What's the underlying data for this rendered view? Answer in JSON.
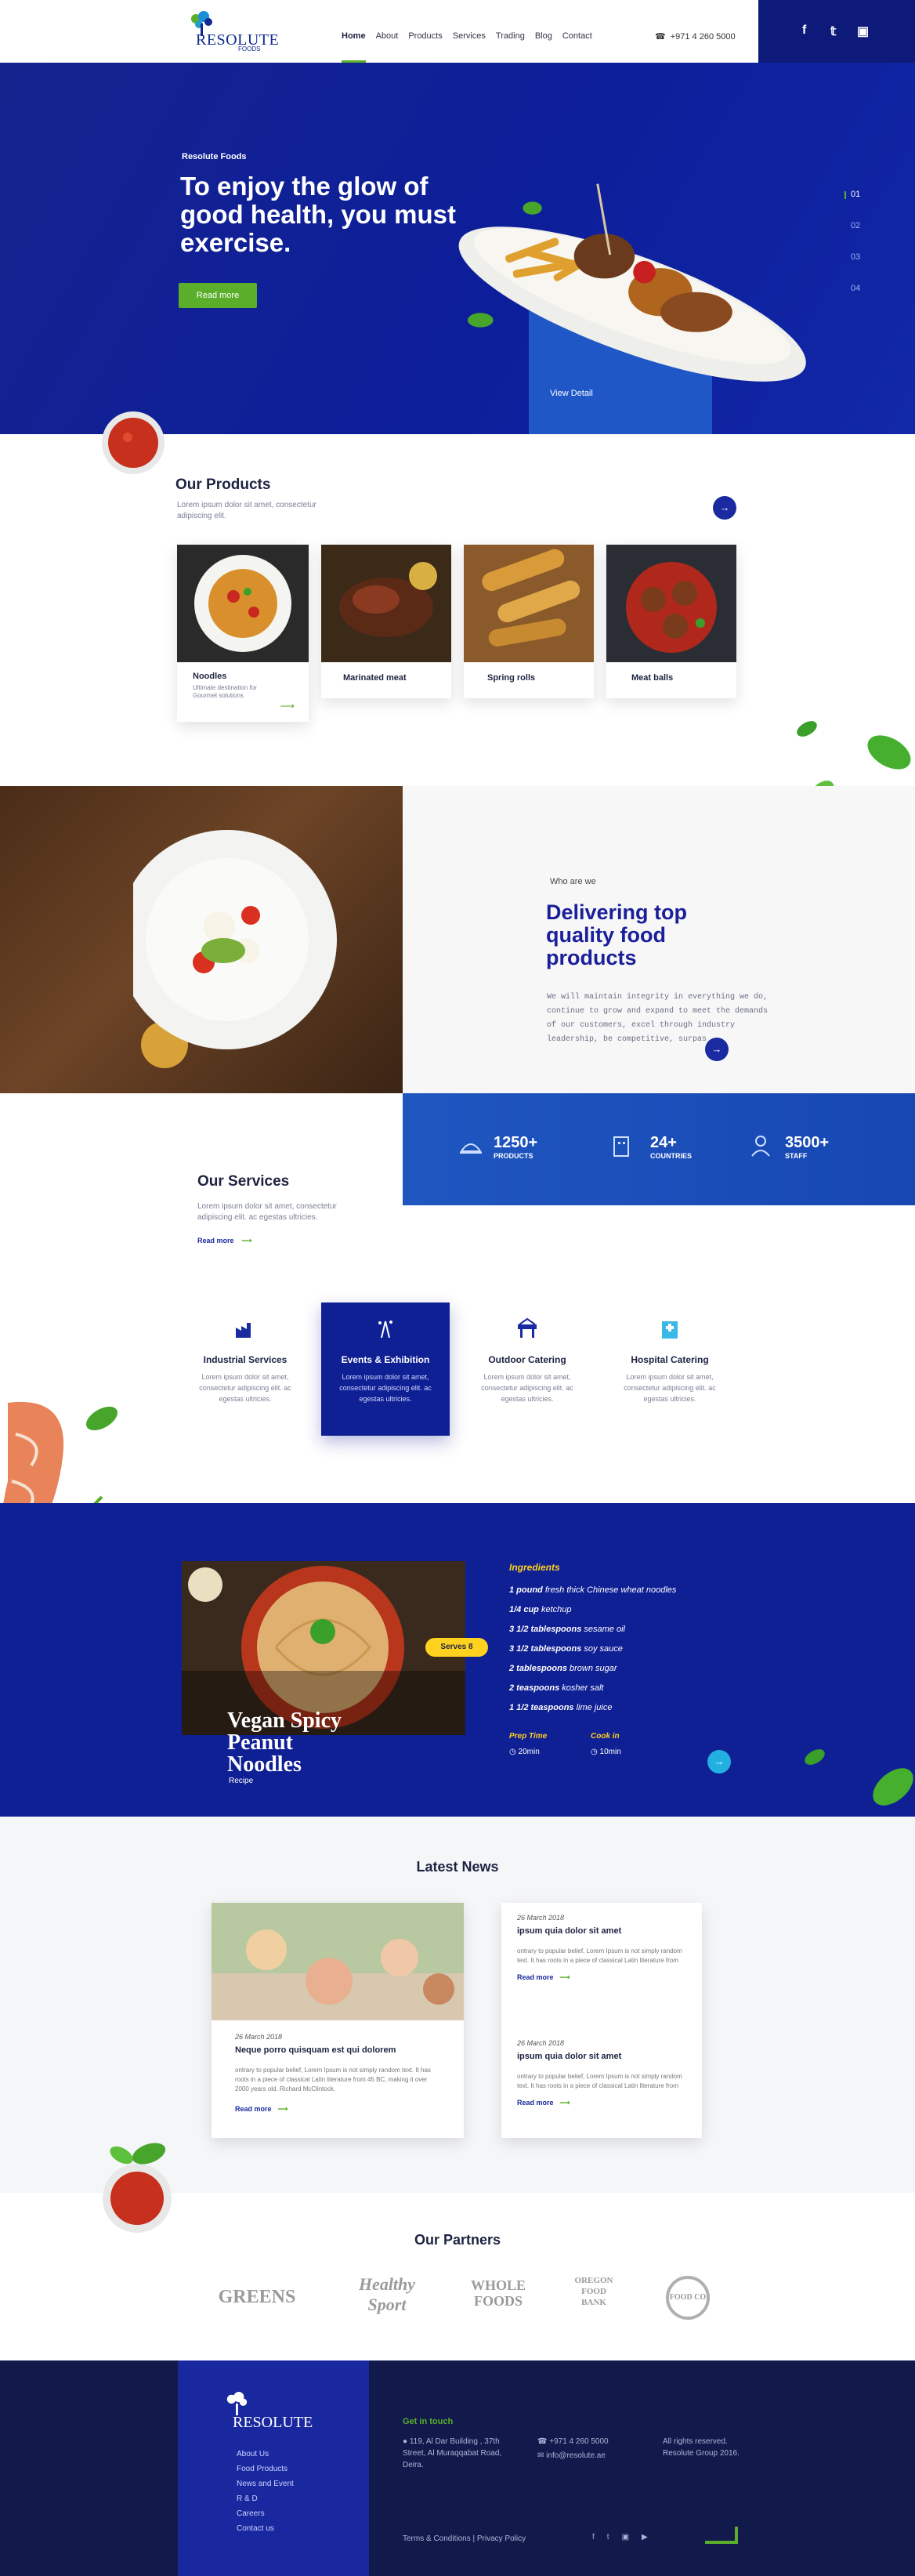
{
  "header": {
    "logo_text": "RESOLUTE",
    "logo_sub": "FOODS",
    "nav": [
      "Home",
      "About",
      "Products",
      "Services",
      "Trading",
      "Blog",
      "Contact"
    ],
    "phone": "+971 4 260 5000",
    "social": [
      "f",
      "t",
      "ig"
    ]
  },
  "hero": {
    "kicker": "Resolute Foods",
    "title": "To enjoy the glow of good health, you must exercise.",
    "cta": "Read more",
    "view_detail": "View Detail",
    "slides": [
      "01",
      "02",
      "03",
      "04"
    ]
  },
  "products": {
    "title": "Our Products",
    "desc": "Lorem ipsum dolor sit amet, consectetur adipiscing elit.",
    "items": [
      {
        "name": "Noodles",
        "desc": "Ultimate destination for Gourmet solutions"
      },
      {
        "name": "Marinated meat"
      },
      {
        "name": "Spring rolls"
      },
      {
        "name": "Meat balls"
      }
    ]
  },
  "about": {
    "kicker": "Who are we",
    "title": "Delivering top quality food products",
    "text": "We will maintain integrity in everything we do, continue to grow and expand to meet the demands of our customers, excel through industry leadership, be competitive, surpas"
  },
  "stats": [
    {
      "num": "1250+",
      "label": "PRODUCTS"
    },
    {
      "num": "24+",
      "label": "COUNTRIES"
    },
    {
      "num": "3500+",
      "label": "STAFF"
    }
  ],
  "services": {
    "title": "Our Services",
    "desc": "Lorem ipsum dolor sit amet, consectetur adipiscing elit. ac egestas ultricies.",
    "read_more": "Read more",
    "items": [
      {
        "title": "Industrial Services",
        "desc": "Lorem ipsum dolor sit amet, consectetur adipiscing elit. ac egestas ultricies."
      },
      {
        "title": "Events & Exhibition",
        "desc": "Lorem ipsum dolor sit amet, consectetur adipiscing elit. ac egestas ultricies."
      },
      {
        "title": "Outdoor Catering",
        "desc": "Lorem ipsum dolor sit amet, consectetur adipiscing elit. ac egestas ultricies."
      },
      {
        "title": "Hospital Catering",
        "desc": "Lorem ipsum dolor sit amet, consectetur adipiscing elit. ac egestas ultricies."
      }
    ]
  },
  "recipe": {
    "name": "Vegan Spicy Peanut Noodles",
    "label": "Recipe",
    "serves": "Serves 8",
    "ingredients_title": "Ingredients",
    "ingredients": [
      {
        "qty": "1 pound",
        "item": "fresh thick Chinese wheat noodles"
      },
      {
        "qty": "1/4 cup",
        "item": "ketchup"
      },
      {
        "qty": "3 1/2 tablespoons",
        "item": "sesame oil"
      },
      {
        "qty": "3 1/2 tablespoons",
        "item": "soy sauce"
      },
      {
        "qty": "2 tablespoons",
        "item": "brown sugar"
      },
      {
        "qty": "2 teaspoons",
        "item": "kosher salt"
      },
      {
        "qty": "1 1/2 teaspoons",
        "item": "lime juice"
      }
    ],
    "prep_label": "Prep Time",
    "prep": "20min",
    "cook_label": "Cook in",
    "cook": "10min"
  },
  "news": {
    "title": "Latest News",
    "featured": {
      "date": "26 March 2018",
      "title": "Neque porro quisquam est qui dolorem",
      "text": "ontrary to popular belief, Lorem Ipsum is not simply random text. It has roots in a piece of classical Latin literature from 45 BC, making it over 2000 years old. Richard McClintock.",
      "read": "Read more"
    },
    "items": [
      {
        "date": "26 March 2018",
        "title": "ipsum quia dolor sit amet",
        "text": "ontrary to popular belief, Lorem Ipsum is not simply random text. It has roots in a piece of classical Latin literature from",
        "read": "Read more"
      },
      {
        "date": "26 March 2018",
        "title": "ipsum quia dolor sit amet",
        "text": "ontrary to popular belief, Lorem Ipsum is not simply random text. It has roots in a piece of classical Latin literature from",
        "read": "Read more"
      }
    ]
  },
  "partners": {
    "title": "Our Partners",
    "items": [
      "GREENS",
      "Healthy Sport",
      "WHOLE FOODS",
      "OREGON FOOD BANK",
      "FOOD CO"
    ]
  },
  "footer": {
    "logo_text": "RESOLUTE",
    "links": [
      "About Us",
      "Food Products",
      "News and Event",
      "R & D",
      "Careers",
      "Contact us"
    ],
    "get_in_touch": "Get in touch",
    "address": "119, Al Dar Building , 37th Street, Al Muraqqabat Road, Deira.",
    "phone": "+971 4 260 5000",
    "email": "info@resolute.ae",
    "rights": "All rights reserved. Resolute Group 2016.",
    "legal": "Terms & Conditions | Privacy Policy"
  },
  "colors": {
    "primary": "#0f1f94",
    "accent": "#5aae2a",
    "yellow": "#ffd21f"
  }
}
